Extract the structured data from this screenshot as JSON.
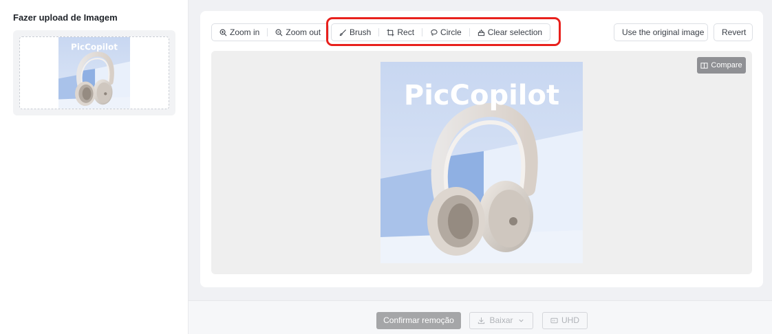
{
  "left_panel": {
    "title": "Fazer upload de Imagem",
    "thumbnail_watermark": "PicCopilot"
  },
  "toolbar": {
    "zoom_in_label": "Zoom in",
    "zoom_out_label": "Zoom out",
    "brush_label": "Brush",
    "rect_label": "Rect",
    "circle_label": "Circle",
    "clear_selection_label": "Clear selection",
    "use_original_label": "Use the original image",
    "revert_label": "Revert"
  },
  "canvas": {
    "watermark": "PicCopilot",
    "compare_label": "Compare"
  },
  "bottom_bar": {
    "confirm_label": "Confirmar remoção",
    "download_label": "Baixar",
    "uhd_label": "UHD"
  },
  "colors": {
    "highlight": "#e8201c",
    "image_background": "#cfdcf2"
  }
}
